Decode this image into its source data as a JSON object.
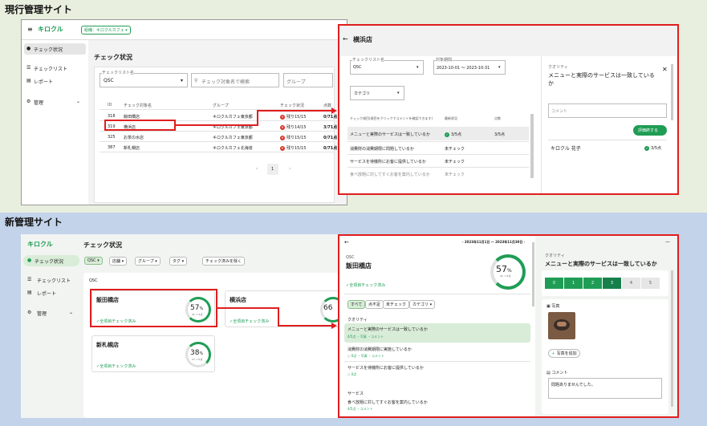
{
  "top_title": "現行管理サイト",
  "bottom_title": "新管理サイト",
  "old": {
    "store_label": "組織：キロクルカフェ",
    "nav": [
      "チェック状況",
      "チェックリスト",
      "レポート",
      "管理"
    ],
    "page_title": "チェック状況",
    "checklist_label": "チェックリスト名",
    "checklist_value": "QSC",
    "search_placeholder": "チェック対象名で検索",
    "group_placeholder": "グループ",
    "columns": [
      "ID",
      "チェック対象名",
      "グループ",
      "チェック状況",
      "点数"
    ],
    "rows": [
      {
        "id": "318",
        "name": "飯田橋店",
        "group": "キロクルカフェ東京都",
        "status": "残り15/15",
        "score": "0/71点"
      },
      {
        "id": "319",
        "name": "横浜店",
        "group": "キロクルカフェ東京都",
        "status": "残り14/15",
        "score": "3/71点"
      },
      {
        "id": "325",
        "name": "お茶の水店",
        "group": "キロクルカフェ東京都",
        "status": "残り15/15",
        "score": "0/71点"
      },
      {
        "id": "387",
        "name": "新札幌店",
        "group": "キロクルカフェ北海道",
        "status": "残り15/15",
        "score": "0/71点"
      }
    ],
    "page": "1",
    "detail": {
      "title": "横浜店",
      "checklist_label": "チェックリスト名",
      "checklist_value": "QSC",
      "period_label": "対象期間",
      "period_value": "2023-10-01 〜 2023-10-31",
      "category": "カテゴリ",
      "list_header": [
        "チェック項目(項目をクリックでコメントを確認できます)",
        "最新状況",
        "点数"
      ],
      "items": [
        {
          "text": "メニューと実際のサービスは一致しているか",
          "status": "3/5点",
          "score": "3/5点"
        },
        {
          "text": "消費財の消費期限に問題しているか",
          "status": "未チェック",
          "score": ""
        },
        {
          "text": "サービスを待機所にお客に提供しているか",
          "status": "未チェック",
          "score": ""
        },
        {
          "text": "食べ放題に対してすぐお客を案内しているか",
          "status": "未チェック",
          "score": ""
        }
      ],
      "popup": {
        "category": "クオリティ",
        "question": "メニューと実際のサービスは一致しているか",
        "comment_placeholder": "コメント",
        "submit": "評価終する",
        "user": "キロクル 花子",
        "user_score": "3/5点"
      }
    }
  },
  "new": {
    "nav": [
      "チェック状況",
      "チェックリスト",
      "レポート",
      "管理"
    ],
    "page_title": "チェック状況",
    "filters": [
      "QSC",
      "店舗",
      "グループ",
      "タグ",
      "チェック済みを除く"
    ],
    "section_label": "QSC",
    "cards": [
      {
        "name": "飯田橋店",
        "percent": "57",
        "percent_unit": "%",
        "fraction": "41 / 71点",
        "note": "✓全項目チェック済み"
      },
      {
        "name": "横浜店",
        "percent": "66",
        "percent_unit": "",
        "fraction": "",
        "note": "✓全項目チェック済み"
      },
      {
        "name": "新札幌店",
        "percent": "38",
        "percent_unit": "%",
        "fraction": "27 / 71点",
        "note": "✓全項目チェック済み"
      }
    ],
    "detail": {
      "period": "2023年11月1日 〜 2023年11月30日",
      "checklist": "QSC",
      "title": "飯田橋店",
      "percent": "57",
      "percent_unit": "%",
      "fraction": "41 / 71点",
      "note": "✓全項目チェック済み",
      "filter_tabs": [
        "すべて",
        "点不足",
        "未チェック",
        "カテゴリ"
      ],
      "sections": [
        {
          "name": "クオリティ",
          "items": [
            {
              "text": "メニューと実際のサービスは一致しているか",
              "meta": "4/5点 ・写真 ・コメント"
            },
            {
              "text": "消費財の消費期限に実施しているか",
              "meta": "0点 ・写真 ・コメント"
            },
            {
              "text": "サービスを待機所にお客に提供しているか",
              "meta": "0点"
            }
          ]
        },
        {
          "name": "サービス",
          "items": [
            {
              "text": "食べ放題に対してすぐお客を案内しているか",
              "meta": "4/5点 ・コメント"
            }
          ]
        }
      ],
      "right": {
        "category": "クオリティ",
        "question": "メニューと実際のサービスは一致しているか",
        "scores": [
          "0",
          "1",
          "2",
          "3",
          "4",
          "5"
        ],
        "photo_label": "写真",
        "add_photo": "写真を追加",
        "comment_label": "コメント",
        "comment_text": "問題ありませんでした。"
      }
    }
  }
}
